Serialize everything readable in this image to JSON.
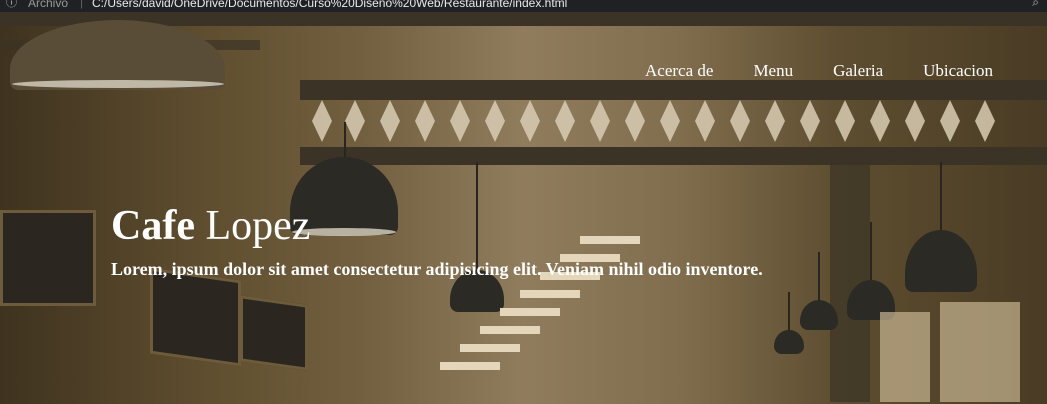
{
  "browser": {
    "scheme_label": "Archivo",
    "url": "C:/Users/david/OneDrive/Documentos/Curso%20Diseño%20Web/Restaurante/index.html"
  },
  "nav": {
    "items": [
      "Acerca de",
      "Menu",
      "Galeria",
      "Ubicacion"
    ]
  },
  "hero": {
    "title_bold": "Cafe",
    "title_rest": " Lopez",
    "subtitle": "Lorem, ipsum dolor sit amet consectetur adipisicing elit. Veniam nihil odio inventore."
  },
  "icons": {
    "address_info": "info-icon",
    "zoom": "zoom-icon"
  }
}
